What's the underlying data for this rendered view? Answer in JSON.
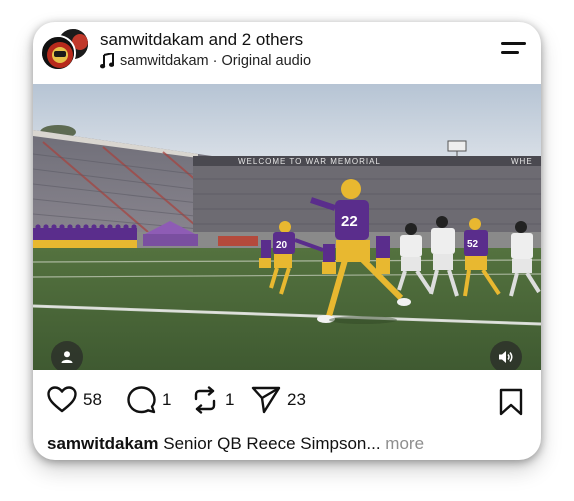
{
  "post": {
    "username": "samwitdakam",
    "coauthors": "and 2 others",
    "audio_user": "samwitdakam",
    "audio_sep": " · ",
    "audio_label": "Original audio"
  },
  "media": {
    "stadium_sign": "WELCOME TO WAR MEMORIAL",
    "sign_right": "WHE",
    "jersey_numbers": [
      "22",
      "20",
      "52"
    ]
  },
  "actions": {
    "likes": "58",
    "comments": "1",
    "reposts": "1",
    "shares": "23"
  },
  "caption": {
    "username": "samwitdakam",
    "text": "Senior QB Reece Simpson...",
    "more": "more"
  },
  "icons": {
    "audio": "music-note-icon",
    "menu": "menu-icon",
    "user": "user-icon",
    "sound": "speaker-icon",
    "like": "heart-icon",
    "comment": "comment-icon",
    "repost": "repost-icon",
    "share": "send-icon",
    "save": "bookmark-icon"
  },
  "colors": {
    "team_purple": "#5a2d8c",
    "team_gold": "#e8b830",
    "field_green": "#4c6a3a",
    "more_text": "#8e8e8e"
  }
}
